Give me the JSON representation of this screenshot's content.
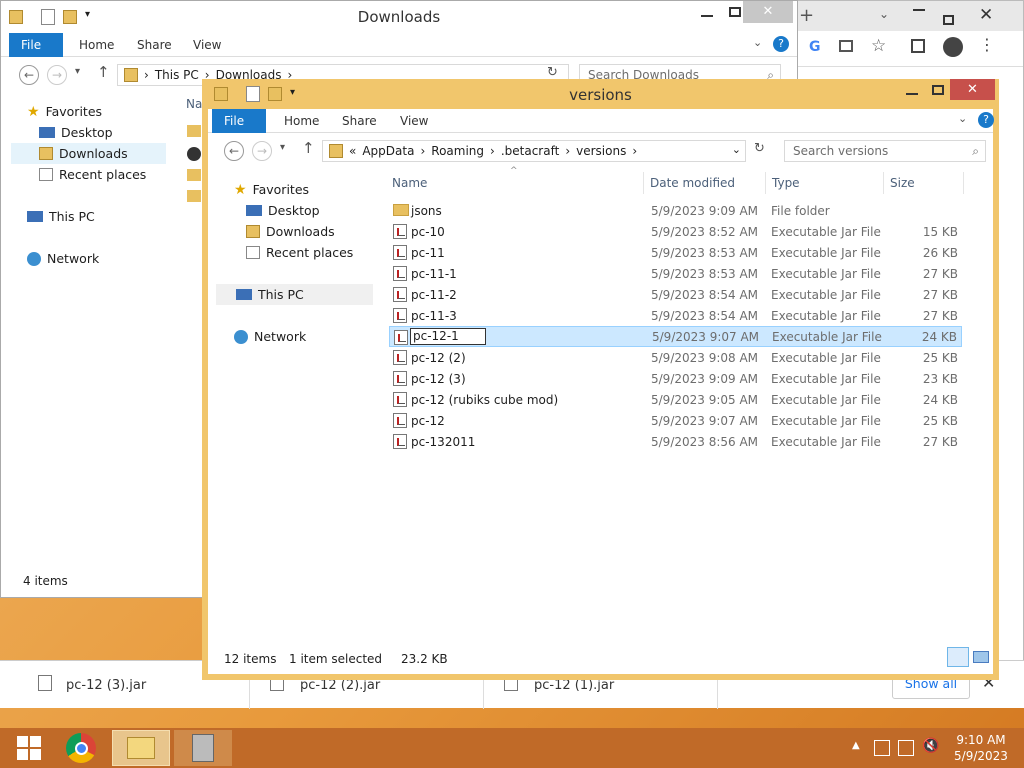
{
  "back_window": {
    "title": "Downloads",
    "ribbon": [
      "File",
      "Home",
      "Share",
      "View"
    ],
    "path": [
      "This PC",
      "Downloads"
    ],
    "search_placeholder": "Search Downloads",
    "nav": [
      "Favorites",
      "Desktop",
      "Downloads",
      "Recent places",
      "This PC",
      "Network"
    ],
    "status": "4 items",
    "col_name_partial": "Na"
  },
  "front_window": {
    "title": "versions",
    "ribbon": [
      "File",
      "Home",
      "Share",
      "View"
    ],
    "path_prefix": "«",
    "path": [
      "AppData",
      "Roaming",
      ".betacraft",
      "versions"
    ],
    "search_placeholder": "Search versions",
    "nav": [
      "Favorites",
      "Desktop",
      "Downloads",
      "Recent places",
      "This PC",
      "Network"
    ],
    "columns": [
      "Name",
      "Date modified",
      "Type",
      "Size"
    ],
    "files": [
      {
        "name": "jsons",
        "date": "5/9/2023 9:09 AM",
        "type": "File folder",
        "size": "",
        "folder": true
      },
      {
        "name": "pc-10",
        "date": "5/9/2023 8:52 AM",
        "type": "Executable Jar File",
        "size": "15 KB"
      },
      {
        "name": "pc-11",
        "date": "5/9/2023 8:53 AM",
        "type": "Executable Jar File",
        "size": "26 KB"
      },
      {
        "name": "pc-11-1",
        "date": "5/9/2023 8:53 AM",
        "type": "Executable Jar File",
        "size": "27 KB"
      },
      {
        "name": "pc-11-2",
        "date": "5/9/2023 8:54 AM",
        "type": "Executable Jar File",
        "size": "27 KB"
      },
      {
        "name": "pc-11-3",
        "date": "5/9/2023 8:54 AM",
        "type": "Executable Jar File",
        "size": "27 KB"
      },
      {
        "name": "pc-12-1",
        "date": "5/9/2023 9:07 AM",
        "type": "Executable Jar File",
        "size": "24 KB",
        "selected": true
      },
      {
        "name": "pc-12 (2)",
        "date": "5/9/2023 9:08 AM",
        "type": "Executable Jar File",
        "size": "25 KB"
      },
      {
        "name": "pc-12 (3)",
        "date": "5/9/2023 9:09 AM",
        "type": "Executable Jar File",
        "size": "23 KB"
      },
      {
        "name": "pc-12 (rubiks cube mod)",
        "date": "5/9/2023 9:05 AM",
        "type": "Executable Jar File",
        "size": "24 KB"
      },
      {
        "name": "pc-12",
        "date": "5/9/2023 9:07 AM",
        "type": "Executable Jar File",
        "size": "25 KB"
      },
      {
        "name": "pc-132011",
        "date": "5/9/2023 8:56 AM",
        "type": "Executable Jar File",
        "size": "27 KB"
      }
    ],
    "status_items": "12 items",
    "status_selected": "1 item selected",
    "status_size": "23.2 KB"
  },
  "downloads_bar": {
    "items": [
      "pc-12 (3).jar",
      "pc-12 (2).jar",
      "pc-12 (1).jar"
    ],
    "show_all": "Show all"
  },
  "taskbar": {
    "time": "9:10 AM",
    "date": "5/9/2023"
  },
  "colors": {
    "accent": "#1979ca",
    "selection": "#cce8ff",
    "title_active": "#f1c66c",
    "close": "#c7504b"
  }
}
